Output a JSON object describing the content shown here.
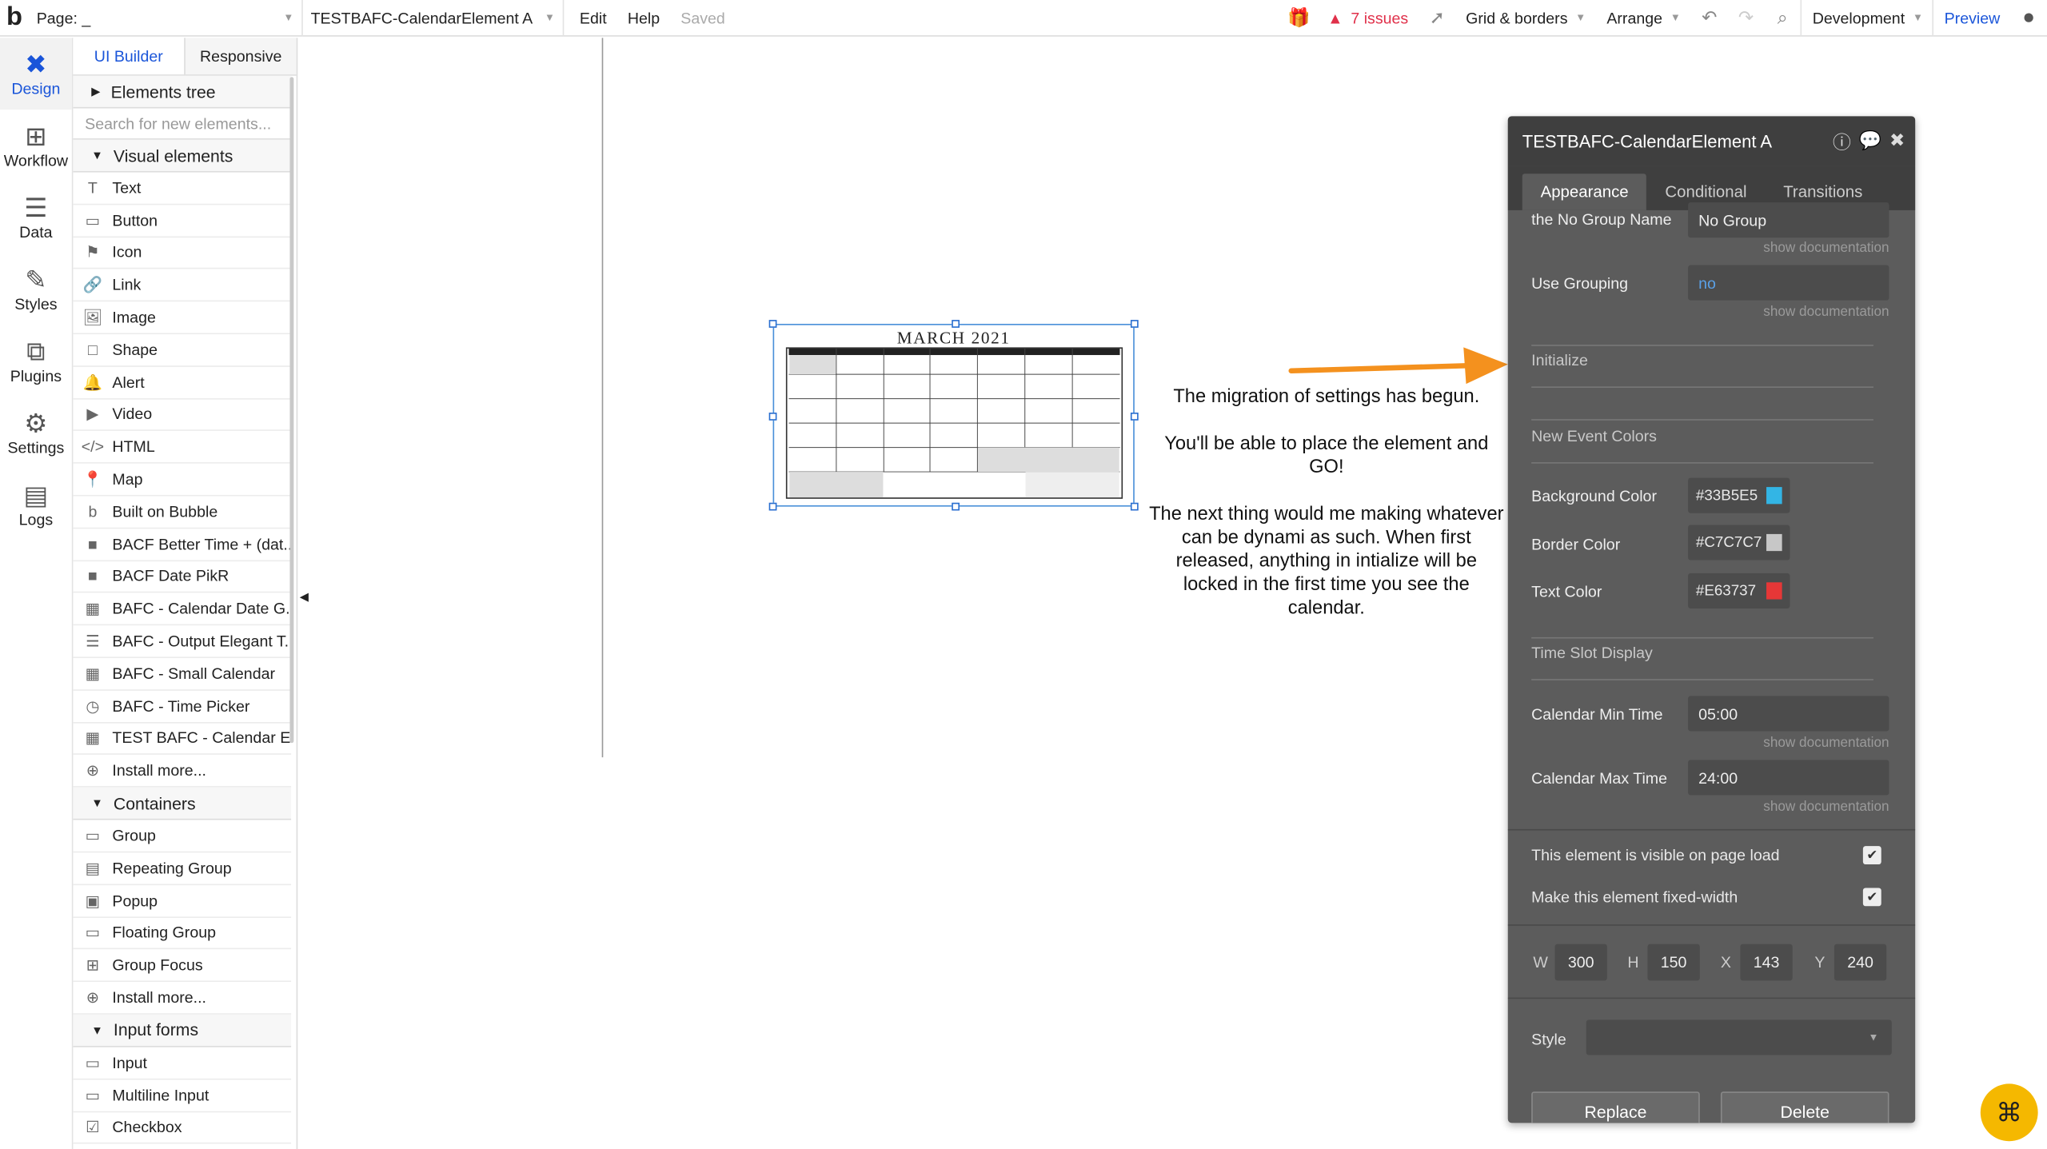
{
  "topbar": {
    "page_label": "Page: _",
    "element_label": "TESTBAFC-CalendarElement A",
    "menu_edit": "Edit",
    "menu_help": "Help",
    "status": "Saved",
    "issues": "7 issues",
    "grid": "Grid & borders",
    "arrange": "Arrange",
    "env": "Development",
    "preview": "Preview",
    "accent": "#1a55d9",
    "issue_color": "#e0304a"
  },
  "sidenav": [
    {
      "label": "Design",
      "icon": "design-icon"
    },
    {
      "label": "Workflow",
      "icon": "workflow-icon"
    },
    {
      "label": "Data",
      "icon": "database-icon"
    },
    {
      "label": "Styles",
      "icon": "brush-icon"
    },
    {
      "label": "Plugins",
      "icon": "plugin-icon"
    },
    {
      "label": "Settings",
      "icon": "gear-icon"
    },
    {
      "label": "Logs",
      "icon": "document-icon"
    }
  ],
  "panel": {
    "tab_ui": "UI Builder",
    "tab_responsive": "Responsive",
    "elements_tree": "Elements tree",
    "search_placeholder": "Search for new elements...",
    "visual_header": "Visual elements",
    "visual": [
      "Text",
      "Button",
      "Icon",
      "Link",
      "Image",
      "Shape",
      "Alert",
      "Video",
      "HTML",
      "Map",
      "Built on Bubble",
      "BACF Better Time + (dat...",
      "BACF Date PikR",
      "BAFC - Calendar Date G...",
      "BAFC - Output Elegant T...",
      "BAFC - Small Calendar",
      "BAFC - Time Picker",
      "TEST BAFC - Calendar El...",
      "Install more..."
    ],
    "containers_header": "Containers",
    "containers": [
      "Group",
      "Repeating Group",
      "Popup",
      "Floating Group",
      "Group Focus",
      "Install more..."
    ],
    "inputs_header": "Input forms",
    "inputs": [
      "Input",
      "Multiline Input",
      "Checkbox"
    ]
  },
  "canvas": {
    "calendar_title": "MARCH  2021",
    "annotation_1": "The migration of settings has begun.",
    "annotation_2": "You'll be able to place the element and GO!",
    "annotation_3": "The next thing would me making whatever can be dynami as such. When first released, anything in intialize will be locked in the first time you see the calendar.",
    "arrow_color": "#f4911e"
  },
  "props": {
    "title": "TESTBAFC-CalendarElement A",
    "tabs": [
      "Appearance",
      "Conditional",
      "Transitions"
    ],
    "group_name_label": "the No Group Name",
    "group_name_value": "No Group",
    "show_doc": "show documentation",
    "use_grouping_label": "Use Grouping",
    "use_grouping_value": "no",
    "initialize": "Initialize",
    "new_event_colors": "New Event Colors",
    "bg_label": "Background Color",
    "bg_value": "#33B5E5",
    "border_label": "Border Color",
    "border_value": "#C7C7C7",
    "text_label": "Text Color",
    "text_value": "#E63737",
    "time_slot": "Time Slot Display",
    "min_label": "Calendar Min Time",
    "min_value": "05:00",
    "max_label": "Calendar Max Time",
    "max_value": "24:00",
    "visible_label": "This element is visible on page load",
    "fixed_label": "Make this element fixed-width",
    "w_label": "W",
    "w_value": "300",
    "h_label": "H",
    "h_value": "150",
    "x_label": "X",
    "x_value": "143",
    "y_label": "Y",
    "y_value": "240",
    "style_label": "Style",
    "replace": "Replace",
    "delete": "Delete"
  }
}
